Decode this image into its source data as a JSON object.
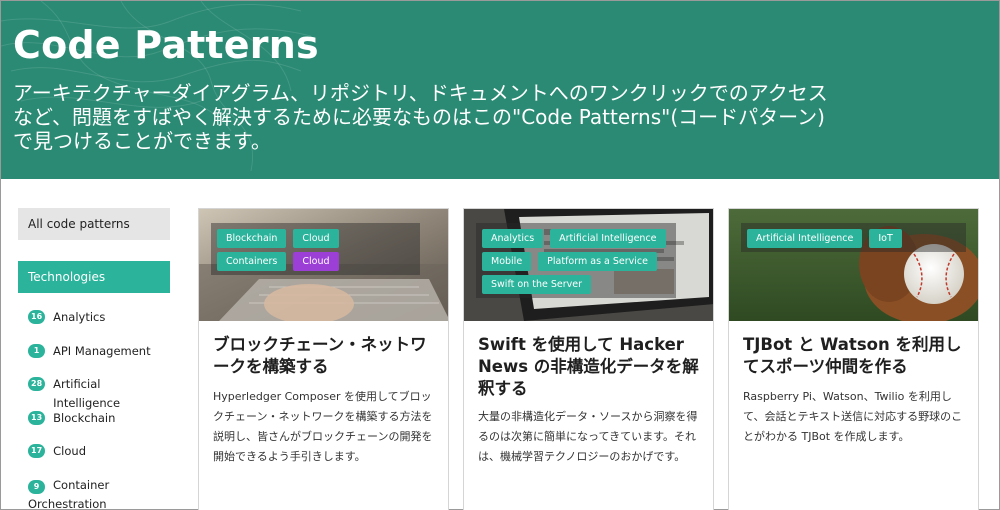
{
  "hero": {
    "title": "Code Patterns",
    "description": "アーキテクチャーダイアグラム、リポジトリ、ドキュメントへのワンクリックでのアクセスなど、問題をすばやく解決するために必要なものはこの\"Code Patterns\"(コードパターン)で見つけることができます。"
  },
  "sidebar": {
    "all_label": "All code patterns",
    "section_label": "Technologies",
    "items": [
      {
        "count": "16",
        "label": "Analytics"
      },
      {
        "count": "1",
        "label": "API Management"
      },
      {
        "count": "28",
        "label": "Artificial Intelligence"
      },
      {
        "count": "13",
        "label": "Blockchain"
      },
      {
        "count": "17",
        "label": "Cloud"
      },
      {
        "count": "9",
        "label": "Container Orchestration"
      }
    ]
  },
  "cards": [
    {
      "tags": [
        "Blockchain",
        "Cloud",
        "Containers",
        "Cloud"
      ],
      "title": "ブロックチェーン・ネットワークを構築する",
      "description": "Hyperledger Composer を使用してブロックチェーン・ネットワークを構築する方法を説明し、皆さんがブロックチェーンの開発を開始できるよう手引きします。"
    },
    {
      "tags": [
        "Analytics",
        "Artificial Intelligence",
        "Mobile",
        "Platform as a Service",
        "Swift on the Server"
      ],
      "title": "Swift を使用して Hacker News の非構造化データを解釈する",
      "description": "大量の非構造化データ・ソースから洞察を得るのは次第に簡単になってきています。それは、機械学習テクノロジーのおかげです。"
    },
    {
      "tags": [
        "Artificial Intelligence",
        "IoT"
      ],
      "title": "TJBot と Watson を利用してスポーツ仲間を作る",
      "description": "Raspberry Pi、Watson、Twilio を利用して、会話とテキスト送信に対応する野球のことがわかる TJBot を作成します。"
    }
  ],
  "colors": {
    "hero_bg": "#2a8a73",
    "accent": "#2bb39b",
    "purple_tag": "#9b3fd6"
  }
}
